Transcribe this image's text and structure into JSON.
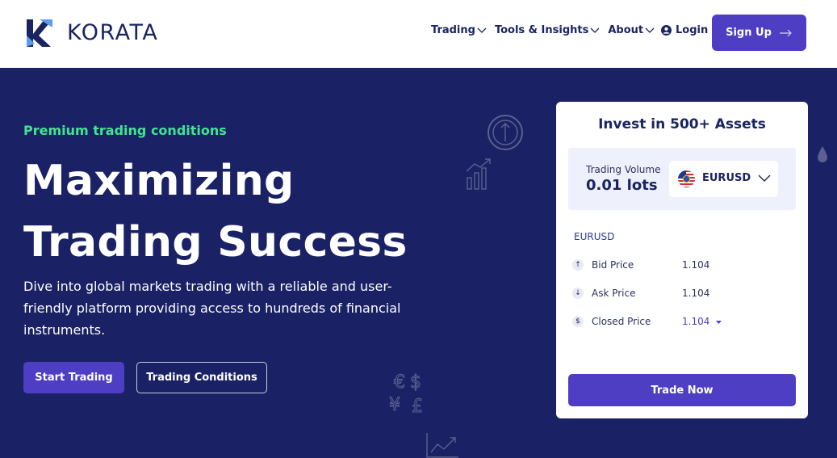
{
  "brand": {
    "name": "KORATA",
    "accent": "#4d3ec4",
    "dark": "#1a2265",
    "highlight": "#41e58f"
  },
  "nav": {
    "items": [
      {
        "label": "Trading",
        "icon": "chevron-down-icon"
      },
      {
        "label": "Tools & Insights",
        "icon": "chevron-down-icon"
      },
      {
        "label": "About",
        "icon": "chevron-down-icon"
      }
    ],
    "login_label": "Login",
    "signup_label": "Sign Up"
  },
  "hero": {
    "tagline": "Premium trading conditions",
    "headline_line1": "Maximizing",
    "headline_line2": "Trading Success",
    "description": "Dive into global markets trading with a reliable and user-friendly platform providing access to hundreds of financial instruments.",
    "primary_button": "Start Trading",
    "secondary_button": "Trading Conditions"
  },
  "card": {
    "title": "Invest in 500+ Assets",
    "volume_label": "Trading Volume",
    "volume_value": "0.01 lots",
    "selected_pair": "EURUSD",
    "pair_heading": "EURUSD",
    "prices": [
      {
        "icon": "arrow-up-icon",
        "label": "Bid Price",
        "value": "1.104"
      },
      {
        "icon": "arrow-down-icon",
        "label": "Ask Price",
        "value": "1.104"
      },
      {
        "icon": "dollar-icon",
        "label": "Closed Price",
        "value": "1.104"
      }
    ],
    "trade_button": "Trade Now"
  }
}
